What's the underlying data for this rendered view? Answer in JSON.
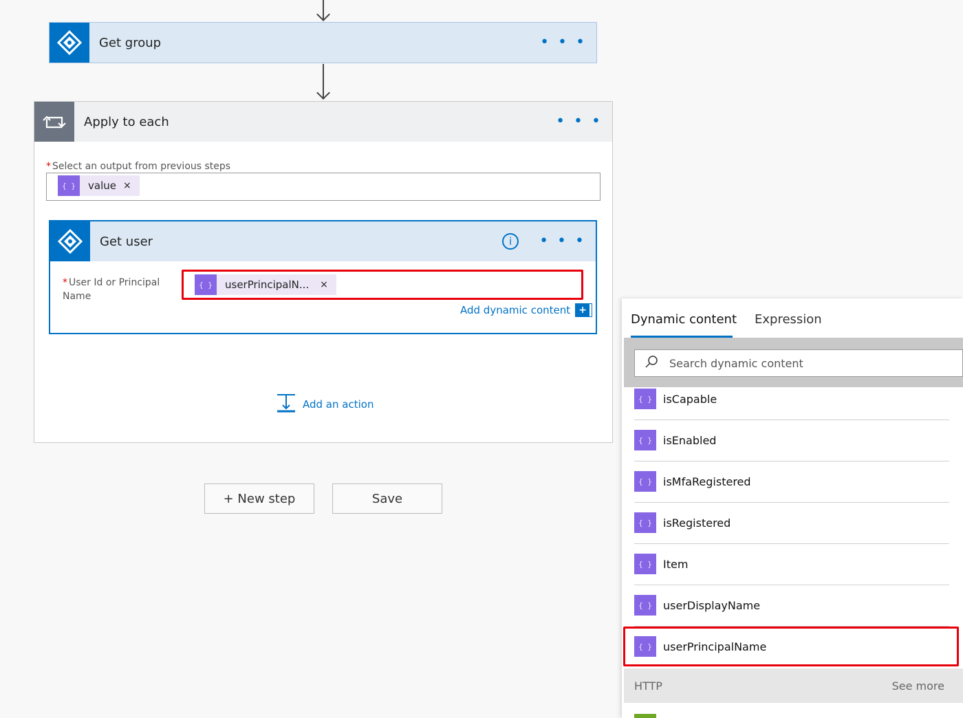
{
  "get_group": {
    "title": "Get group",
    "more": "• • •"
  },
  "apply_each": {
    "title": "Apply to each",
    "more": "• • •",
    "select_label": "Select an output from previous steps",
    "token_label": "value",
    "token_remove": "×",
    "add_action": "Add an action"
  },
  "get_user": {
    "title": "Get user",
    "more": "• • •",
    "info": "i",
    "field_label_1": "User Id or Principal",
    "field_label_2": "Name",
    "token_label": "userPrincipalN...",
    "token_remove": "×",
    "add_dynamic": "Add dynamic content",
    "add_dynamic_icon": "+"
  },
  "buttons": {
    "new_step": "+ New step",
    "save": "Save"
  },
  "dynamic_panel": {
    "tab_dynamic": "Dynamic content",
    "tab_expression": "Expression",
    "search_placeholder": "Search dynamic content",
    "items": [
      "isCapable",
      "isEnabled",
      "isMfaRegistered",
      "isRegistered",
      "Item",
      "userDisplayName",
      "userPrincipalName"
    ],
    "section_title": "HTTP",
    "see_more": "See more"
  },
  "icons": {
    "azure_ad": "azure-ad-icon",
    "loop": "loop-icon",
    "token": "{ }",
    "search": "search-icon",
    "add_action": "add-action-icon",
    "info": "info-icon"
  },
  "colors": {
    "accent": "#0072c6",
    "token": "#8766e6",
    "token_bg": "#ece6f7",
    "highlight": "#e8000b",
    "header_blue": "#dce9f5",
    "loop_gray": "#6b7480"
  }
}
